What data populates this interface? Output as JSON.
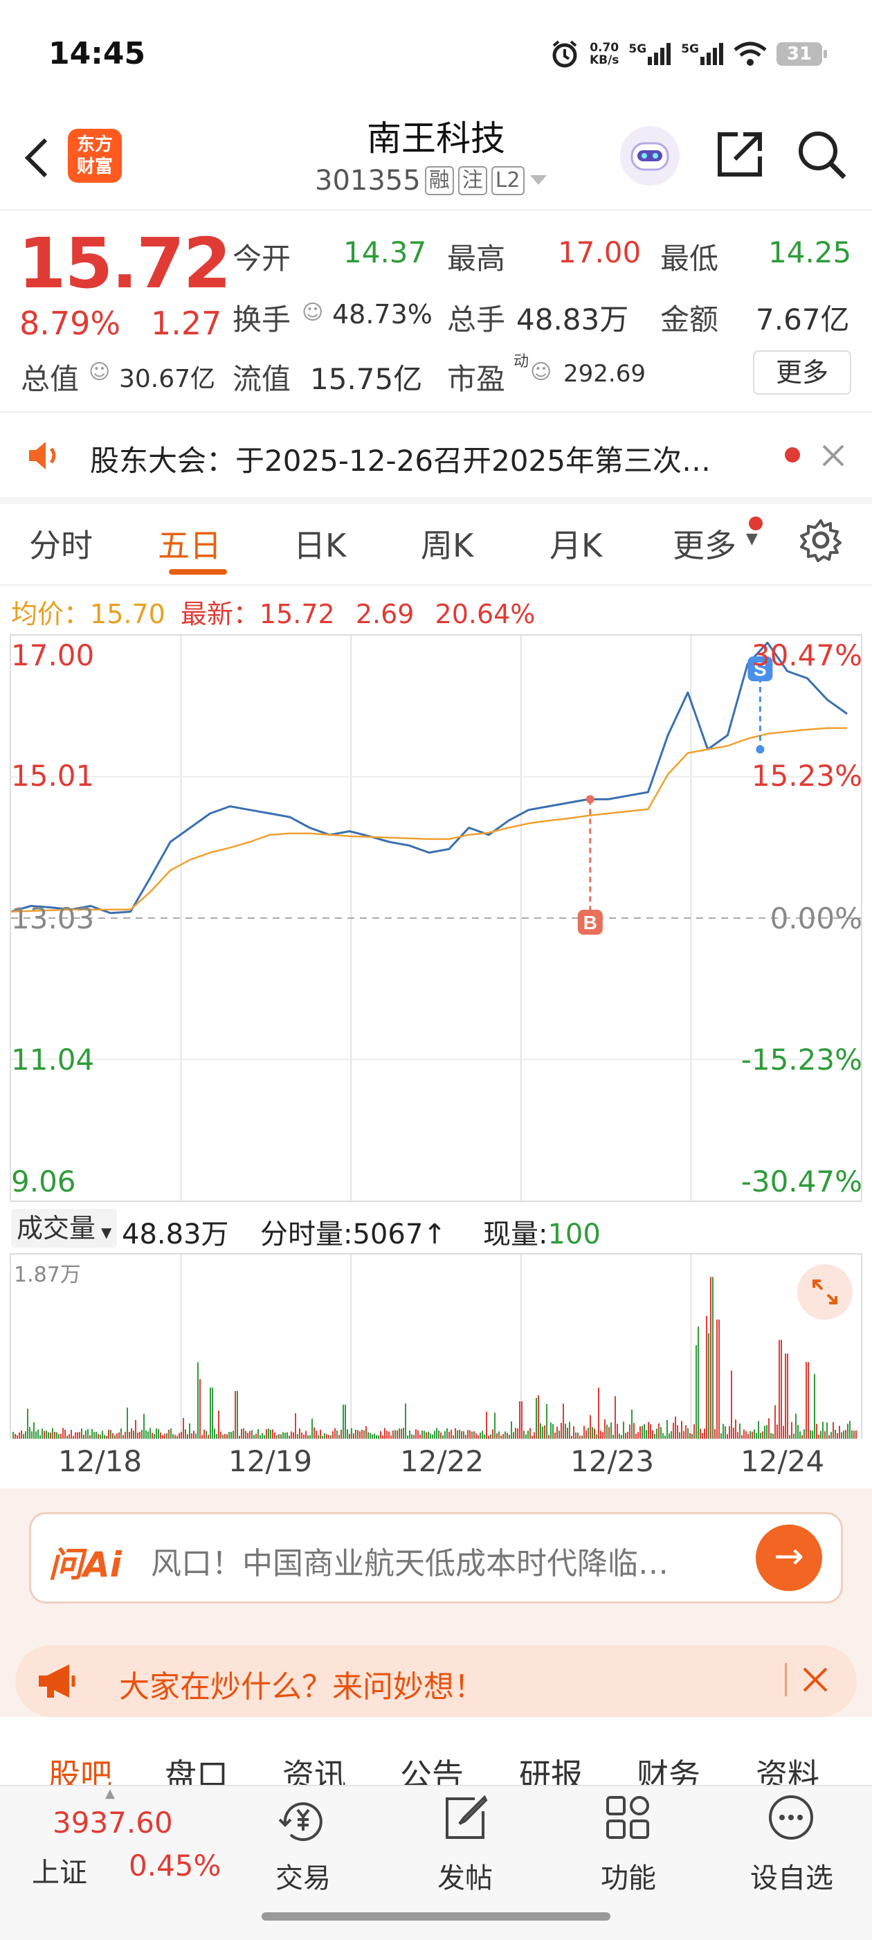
{
  "status_bar": {
    "time": "14:45",
    "net_speed_value": "0.70",
    "net_speed_unit": "KB/s",
    "signal1": "5G",
    "signal2": "5G",
    "battery": "31"
  },
  "header": {
    "back_icon": "chevron-left-icon",
    "logo_text": "东方财富",
    "logo_line1": "东方",
    "logo_line2": "财富",
    "stock_name": "南王科技",
    "stock_code": "301355",
    "tags": [
      "融",
      "注",
      "L2"
    ],
    "share_icon": "share-icon",
    "search_icon": "search-icon"
  },
  "quote": {
    "price": "15.72",
    "change_pct": "8.79%",
    "change_amt": "1.27",
    "open_label": "今开",
    "open": "14.37",
    "high_label": "最高",
    "high": "17.00",
    "low_label": "最低",
    "low": "14.25",
    "turnover_label": "换手",
    "turnover": "48.73%",
    "volume_label": "总手",
    "volume": "48.83万",
    "amount_label": "金额",
    "amount": "7.67亿",
    "mcap_label": "总值",
    "mcap": "30.67亿",
    "float_label": "流值",
    "float_val": "15.75亿",
    "pe_label": "市盈",
    "pe_sup": "动",
    "pe": "292.69",
    "more_button": "更多"
  },
  "notice": {
    "text": "股东大会：于2025-12-26召开2025年第三次…"
  },
  "tabs": [
    "分时",
    "五日",
    "日K",
    "周K",
    "月K",
    "更多"
  ],
  "active_tab": "五日",
  "chart_info": {
    "avg_label": "均价：",
    "avg": "15.70",
    "latest_label": "最新：",
    "latest": "15.72",
    "change": "2.69",
    "change_pct": "20.64%"
  },
  "chart_data": {
    "type": "line",
    "x_labels": [
      "12/18",
      "12/19",
      "12/22",
      "12/23",
      "12/24"
    ],
    "y_ticks_left": [
      "17.00",
      "15.01",
      "13.03",
      "11.04",
      "9.06"
    ],
    "y_ticks_right": [
      "30.47%",
      "15.23%",
      "0.00%",
      "-15.23%",
      "-30.47%"
    ],
    "ylim": [
      9.06,
      17.0
    ],
    "prev_close": 13.03,
    "series": [
      {
        "values": [
          13.12,
          13.2,
          13.18,
          13.15,
          13.2,
          13.1,
          13.12,
          13.6,
          14.1,
          14.3,
          14.5,
          14.6,
          14.55,
          14.5,
          14.45,
          14.3,
          14.2,
          14.25,
          14.18,
          14.1,
          14.05,
          13.95,
          14.0,
          14.3,
          14.2,
          14.4,
          14.55,
          14.6,
          14.65,
          14.7,
          14.7,
          14.75,
          14.8,
          15.6,
          16.2,
          15.4,
          15.6,
          16.6,
          16.9,
          16.5,
          16.4,
          16.1,
          15.9
        ]
      },
      {
        "values": [
          13.12,
          13.13,
          13.14,
          13.15,
          13.15,
          13.15,
          13.15,
          13.4,
          13.7,
          13.85,
          13.95,
          14.02,
          14.1,
          14.2,
          14.22,
          14.22,
          14.2,
          14.18,
          14.17,
          14.16,
          14.15,
          14.14,
          14.14,
          14.2,
          14.23,
          14.3,
          14.36,
          14.4,
          14.43,
          14.47,
          14.5,
          14.53,
          14.56,
          15.05,
          15.35,
          15.4,
          15.45,
          15.55,
          15.62,
          15.65,
          15.68,
          15.7,
          15.7
        ]
      }
    ],
    "markers": [
      {
        "label": "B",
        "date": "12/23",
        "price": 14.7
      },
      {
        "label": "S",
        "date": "12/24",
        "price": 15.4
      }
    ]
  },
  "volume_info": {
    "selector": "成交量",
    "total": "48.83万",
    "tick_label": "分时量:",
    "tick": "5067",
    "tick_arrow": "↑",
    "current_label": "现量:",
    "current": "100",
    "max_label": "1.87万"
  },
  "ai": {
    "logo": "问Ai",
    "text": "风口！中国商业航天低成本时代降临…",
    "go_icon": "arrow-right-icon"
  },
  "promo": {
    "text": "大家在炒什么？来问妙想！"
  },
  "sub_tabs": [
    "股吧",
    "盘口",
    "资讯",
    "公告",
    "研报",
    "财务",
    "资料"
  ],
  "bottom": {
    "index_value": "3937.60",
    "index_name": "上证",
    "index_change": "0.45%",
    "items": [
      "交易",
      "发帖",
      "功能",
      "设自选"
    ]
  },
  "colors": {
    "up": "#e03b35",
    "down": "#2f9b3a",
    "accent": "#e8600f",
    "price_line": "#3a6fb0",
    "avg_line": "#f0a030"
  }
}
